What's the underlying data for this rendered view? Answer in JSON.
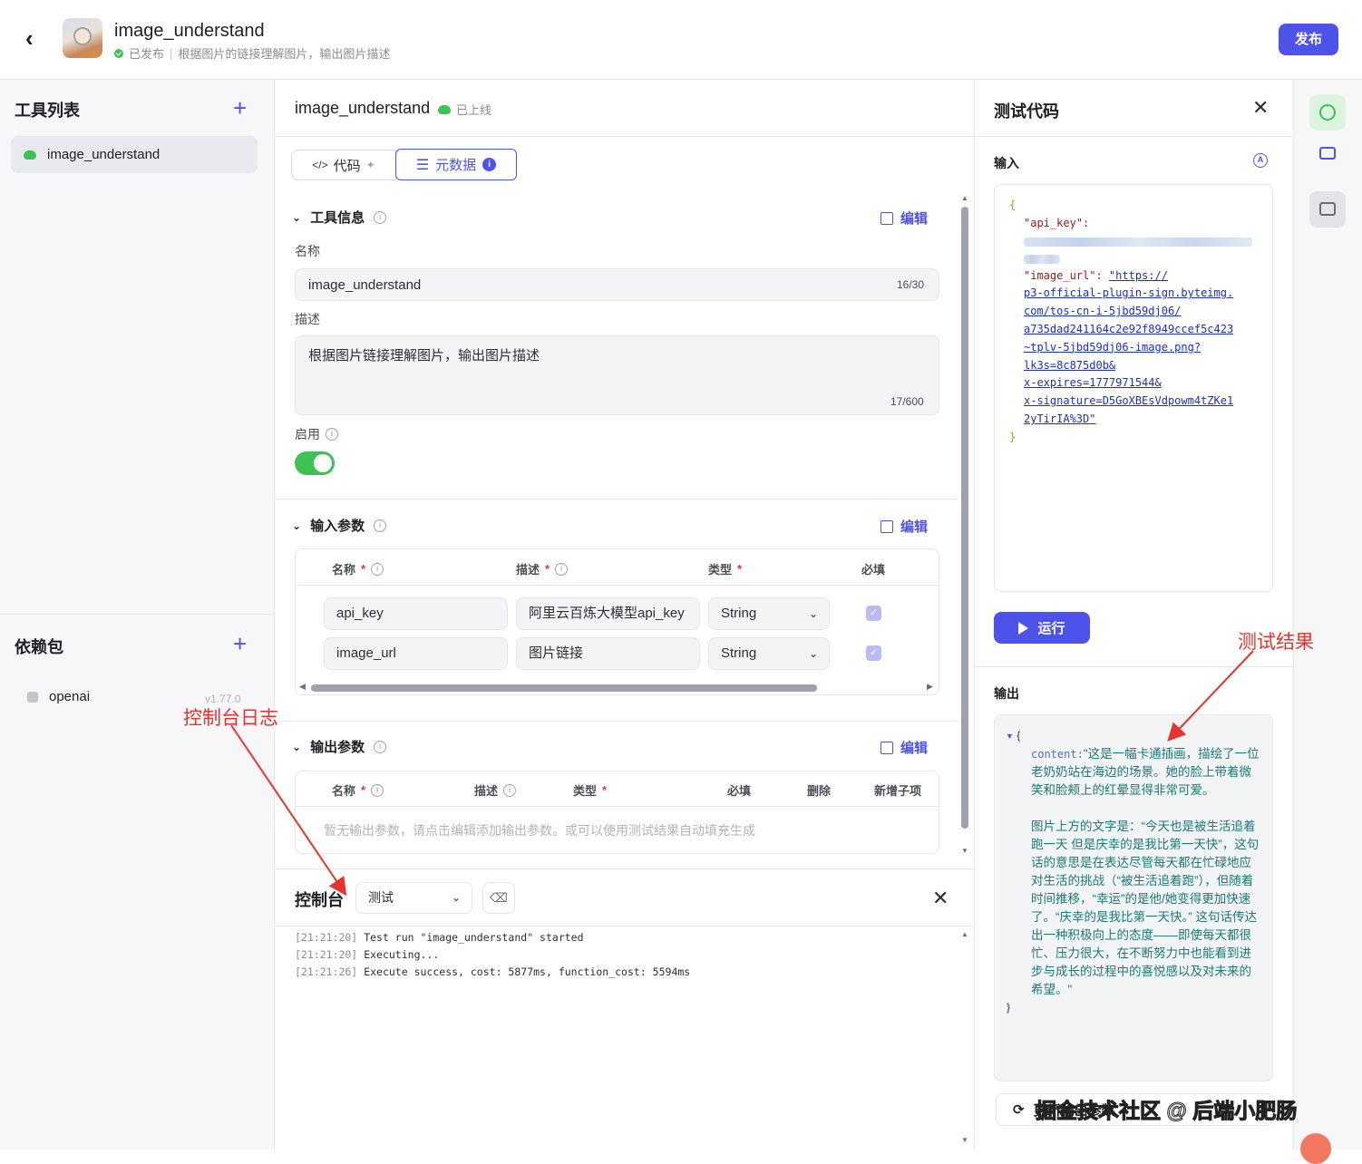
{
  "header": {
    "back_icon": "back-icon",
    "app_name": "image_understand",
    "status": "已发布",
    "description": "根据图片的链接理解图片，输出图片描述",
    "publish_label": "发布"
  },
  "sidebar": {
    "tools_title": "工具列表",
    "tools": [
      {
        "label": "image_understand"
      }
    ],
    "deps_title": "依赖包",
    "deps": [
      {
        "label": "openai",
        "version": "v1.77.0"
      }
    ]
  },
  "center": {
    "title": "image_understand",
    "online_status": "已上线",
    "tabs": [
      {
        "label": "代码"
      },
      {
        "label": "元数据"
      }
    ],
    "tool_info": {
      "title": "工具信息",
      "edit_label": "编辑",
      "name_label": "名称",
      "name_value": "image_understand",
      "name_count": "16/30",
      "desc_label": "描述",
      "desc_value": "根据图片链接理解图片，输出图片描述",
      "desc_count": "17/600",
      "enable_label": "启用",
      "enabled": true
    },
    "input_params": {
      "title": "输入参数",
      "edit_label": "编辑",
      "headers": [
        "名称",
        "描述",
        "类型",
        "必填"
      ],
      "rows": [
        {
          "name": "api_key",
          "desc": "阿里云百炼大模型api_key",
          "type": "String",
          "required": true
        },
        {
          "name": "image_url",
          "desc": "图片链接",
          "type": "String",
          "required": true
        }
      ]
    },
    "output_params": {
      "title": "输出参数",
      "edit_label": "编辑",
      "headers": [
        "名称",
        "描述",
        "类型",
        "必填",
        "删除",
        "新增子项"
      ],
      "empty_text": "暂无输出参数，请点击编辑添加输出参数。或可以使用测试结果自动填充生成"
    }
  },
  "console": {
    "title": "控制台",
    "mode": "测试",
    "logs": [
      {
        "ts": "[21:21:20]",
        "msg": "Test run \"image_understand\" started"
      },
      {
        "ts": "[21:21:20]",
        "msg": "Executing..."
      },
      {
        "ts": "[21:21:26]",
        "msg": "Execute success, cost: 5877ms, function_cost: 5594ms"
      }
    ]
  },
  "test_panel": {
    "title": "测试代码",
    "input_label": "输入",
    "code": {
      "open": "{",
      "key1": "\"api_key\":",
      "key2": "\"image_url\":",
      "url_lines": [
        "\"https://",
        "p3-official-plugin-sign.byteimg.",
        "com/tos-cn-i-5jbd59dj06/",
        "a735dad241164c2e92f8949ccef5c423",
        "~tplv-5jbd59dj06-image.png?",
        "lk3s=8c875d0b&",
        "x-expires=1777971544&",
        "x-signature=D5GoXBEsVdpowm4tZKe1",
        "2yTirIA%3D\""
      ],
      "close": "}"
    },
    "run_label": "运行",
    "output_label": "输出",
    "output": {
      "open": "{",
      "key": "content:",
      "text": "\"这是一幅卡通插画，描绘了一位老奶奶站在海边的场景。她的脸上带着微笑和脸颊上的红晕显得非常可爱。",
      "text2": "图片上方的文字是：“今天也是被生活追着跑一天 但是庆幸的是我比第一天快”，这句话的意思是在表达尽管每天都在忙碌地应对生活的挑战（“被生活追着跑”），但随着时间推移，“幸运”的是他/她变得更加快速了。“庆幸的是我比第一天快。” 这句话传达出一种积极向上的态度——即使每天都很忙、压力很大，在不断努力中也能看到进步与成长的过程中的喜悦感以及对未来的希望。\"",
      "close": "}"
    },
    "update_label": "更新输出参数"
  },
  "annotations": {
    "test_result": "测试结果",
    "console_log": "控制台日志",
    "watermark": "掘金技术社区 @ 后端小肥肠"
  },
  "colors": {
    "accent": "#4d53e8",
    "success": "#3ec254",
    "annotation": "#e5332d"
  }
}
